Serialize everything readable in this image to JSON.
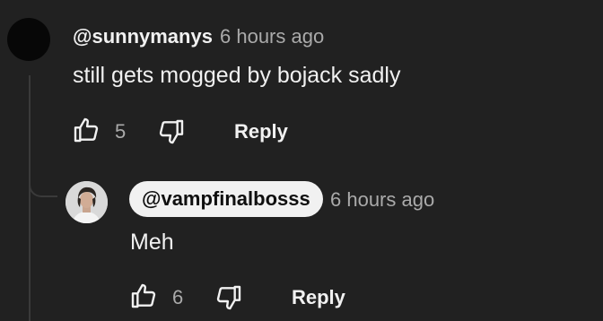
{
  "comment": {
    "author": "@sunnymanys",
    "time": "6 hours ago",
    "text": "still gets mogged by bojack sadly",
    "likes": "5",
    "reply_label": "Reply"
  },
  "reply": {
    "author": "@vampfinalbosss",
    "time": "6 hours ago",
    "text": "Meh",
    "likes": "6",
    "reply_label": "Reply"
  },
  "colors": {
    "background": "#212121",
    "text": "#f1f1f1",
    "secondary_text": "#aaaaaa",
    "author_pill": "#f1f1f1"
  },
  "icons": {
    "like": "thumbs-up-outline",
    "dislike": "thumbs-down-outline"
  }
}
